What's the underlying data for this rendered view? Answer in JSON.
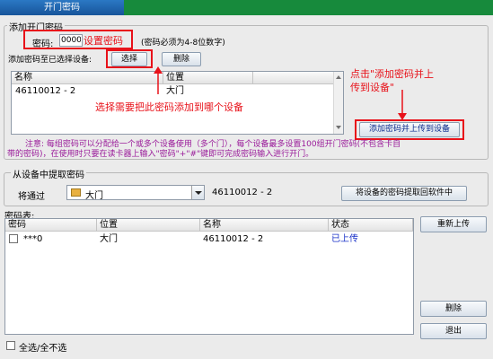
{
  "tab": {
    "label": "开门密码"
  },
  "add_group": {
    "legend": "添加开门密码",
    "password_label": "密码:",
    "password_value": "0000",
    "set_password_annotation": "设置密码",
    "password_hint": "(密码必须为4-8位数字)",
    "add_to_devices_label": "添加密码至已选择设备:",
    "select_button": "选择",
    "delete_button": "删除",
    "device_table": {
      "headers": [
        "名称",
        "位置"
      ],
      "rows": [
        {
          "name": "46110012 - 2",
          "location": "大门"
        }
      ]
    },
    "choose_device_annotation": "选择需要把此密码添加到哪个设备",
    "upload_annotation_line1": "点击\"添加密码并上",
    "upload_annotation_line2": "传到设备\"",
    "upload_button": "添加密码并上传到设备",
    "notice_line1": "注意: 每组密码可以分配给一个或多个设备使用（多个门），每个设备最多设置100组开门密码(不包含卡自",
    "notice_line2": "带的密码)，在使用时只要在读卡器上输入\"密码\"+\"#\"键即可完成密码输入进行开门。"
  },
  "extract_group": {
    "legend": "从设备中提取密码",
    "via_label": "将通过",
    "location_value": "大门",
    "device_value": "46110012 - 2",
    "extract_button": "将设备的密码提取回软件中"
  },
  "password_table": {
    "title": "密码表:",
    "headers": [
      "密码",
      "位置",
      "名称",
      "状态"
    ],
    "rows": [
      {
        "password": "***0",
        "location": "大门",
        "name": "46110012 - 2",
        "status": "已上传",
        "checked": false
      }
    ],
    "status_color": "#1a32c8"
  },
  "actions": {
    "reupload": "重新上传",
    "delete": "删除",
    "exit": "退出"
  },
  "select_all_label": "全选/全不选"
}
